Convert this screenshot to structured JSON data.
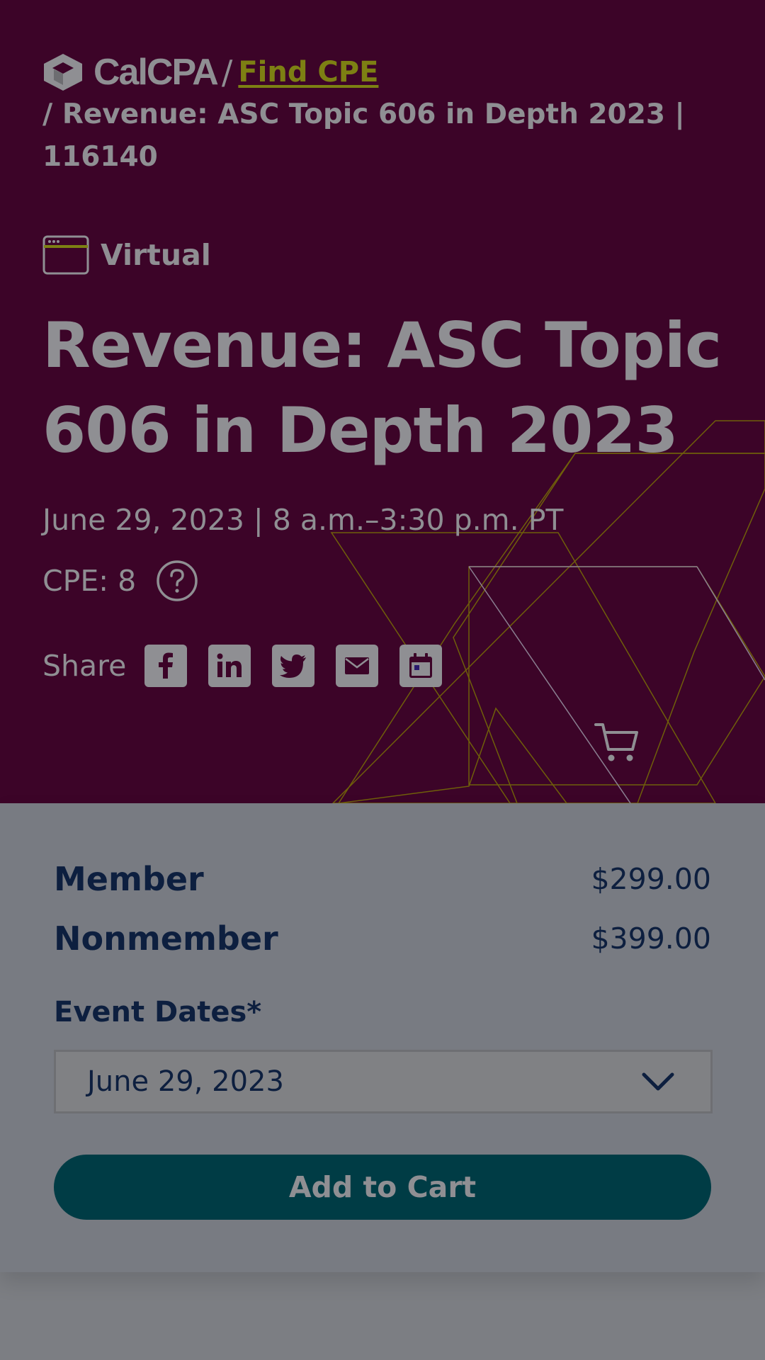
{
  "breadcrumb": {
    "logo_text": "CalCPA",
    "separator": "/",
    "link_label": "Find CPE",
    "current": "/ Revenue: ASC Topic 606 in Depth 2023 | 116140"
  },
  "event": {
    "format": "Virtual",
    "title": "Revenue: ASC Topic 606 in Depth 2023",
    "datetime": "June 29, 2023 | 8 a.m.–3:30 p.m. PT",
    "cpe": "CPE: 8",
    "share_label": "Share"
  },
  "icons": {
    "logo": "calcpa-logo-icon",
    "format": "browser-window-icon",
    "help": "question-mark-circle-icon",
    "share": [
      "facebook-icon",
      "linkedin-icon",
      "twitter-icon",
      "email-icon",
      "calendar-icon"
    ],
    "cart": "shopping-cart-icon",
    "dropdown": "chevron-down-icon"
  },
  "pricing": [
    {
      "label": "Member",
      "price": "$299.00"
    },
    {
      "label": "Nonmember",
      "price": "$399.00"
    }
  ],
  "event_dates": {
    "label": "Event Dates*",
    "selected": "June 29, 2023"
  },
  "cta": {
    "add_to_cart": "Add to Cart"
  },
  "colors": {
    "hero_bg": "#3c0428",
    "link": "#7d8013",
    "text_muted": "#8f8f93",
    "panel_bg": "#787b82",
    "navy": "#0d1f3f",
    "button_bg": "#003c45"
  }
}
